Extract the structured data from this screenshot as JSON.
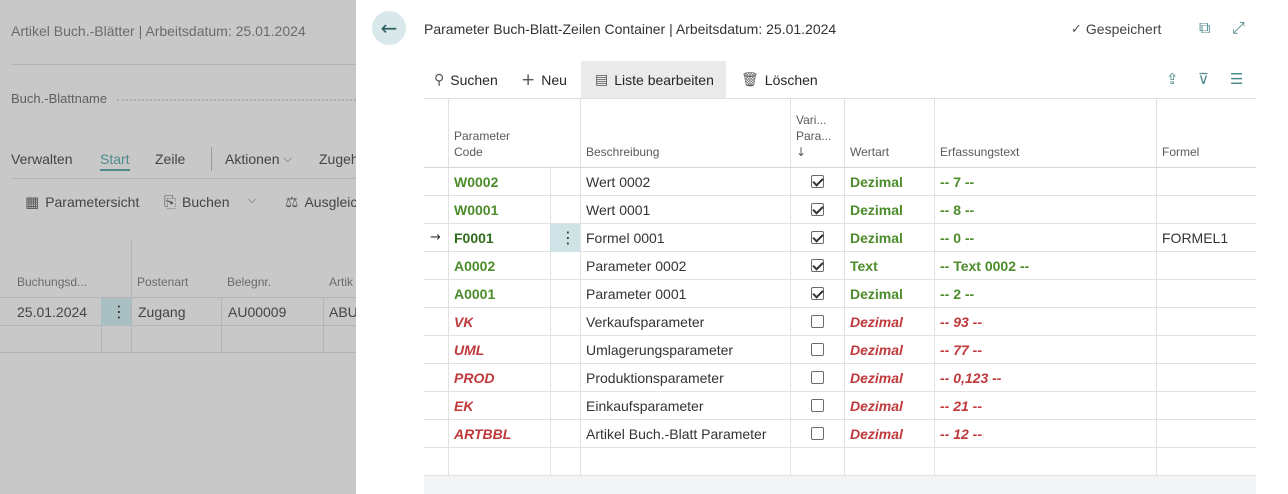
{
  "background": {
    "title": "Artikel Buch.-Blätter | Arbeitsdatum: 25.01.2024",
    "field_label": "Buch.-Blattname",
    "tabs": [
      "Verwalten",
      "Start",
      "Zeile",
      "Aktionen",
      "Zugeh"
    ],
    "active_tab": "Start",
    "actions": [
      "Parametersicht",
      "Buchen",
      "Ausgleic"
    ],
    "columns": [
      "Buchungsd...",
      "Postenart",
      "Belegnr.",
      "Artik"
    ],
    "row": [
      "25.01.2024",
      "Zugang",
      "AU00009",
      "ABU"
    ]
  },
  "panel": {
    "title": "Parameter Buch-Blatt-Zeilen Container | Arbeitsdatum: 25.01.2024",
    "saved_label": "Gespeichert",
    "actions": {
      "search": "Suchen",
      "new": "Neu",
      "edit_list": "Liste bearbeiten",
      "delete": "Löschen"
    },
    "columns": {
      "code_line1": "Parameter",
      "code_line2": "Code",
      "beschreibung": "Beschreibung",
      "var_line1": "Vari...",
      "var_line2": "Para...",
      "var_sort": "↓",
      "wertart": "Wertart",
      "erfassungstext": "Erfassungstext",
      "formel": "Formel"
    },
    "rows": [
      {
        "code": "W0002",
        "beschreibung": "Wert 0002",
        "checked": true,
        "wertart": "Dezimal",
        "erfassung": "-- 7 --",
        "formel": "",
        "style": "green"
      },
      {
        "code": "W0001",
        "beschreibung": "Wert 0001",
        "checked": true,
        "wertart": "Dezimal",
        "erfassung": "-- 8 --",
        "formel": "",
        "style": "green"
      },
      {
        "code": "F0001",
        "beschreibung": "Formel 0001",
        "checked": true,
        "wertart": "Dezimal",
        "erfassung": "-- 0 --",
        "formel": "FORMEL1",
        "style": "green-dark",
        "selected": true
      },
      {
        "code": "A0002",
        "beschreibung": "Parameter 0002",
        "checked": true,
        "wertart": "Text",
        "erfassung": "-- Text 0002 --",
        "formel": "",
        "style": "green"
      },
      {
        "code": "A0001",
        "beschreibung": "Parameter 0001",
        "checked": true,
        "wertart": "Dezimal",
        "erfassung": "-- 2 --",
        "formel": "",
        "style": "green"
      },
      {
        "code": "VK",
        "beschreibung": "Verkaufsparameter",
        "checked": false,
        "wertart": "Dezimal",
        "erfassung": "-- 93 --",
        "formel": "",
        "style": "red"
      },
      {
        "code": "UML",
        "beschreibung": "Umlagerungsparameter",
        "checked": false,
        "wertart": "Dezimal",
        "erfassung": "-- 77 --",
        "formel": "",
        "style": "red"
      },
      {
        "code": "PROD",
        "beschreibung": "Produktionsparameter",
        "checked": false,
        "wertart": "Dezimal",
        "erfassung": "-- 0,123 --",
        "formel": "",
        "style": "red"
      },
      {
        "code": "EK",
        "beschreibung": "Einkaufsparameter",
        "checked": false,
        "wertart": "Dezimal",
        "erfassung": "-- 21 --",
        "formel": "",
        "style": "red"
      },
      {
        "code": "ARTBBL",
        "beschreibung": "Artikel Buch.-Blatt Parameter",
        "checked": false,
        "wertart": "Dezimal",
        "erfassung": "-- 12 --",
        "formel": "",
        "style": "red"
      }
    ]
  },
  "colors": {
    "accent": "#4f8a8c",
    "green_text": "#4c8c2b",
    "red_text": "#c0393b"
  },
  "icons": [
    "back-arrow-icon",
    "checkmark-icon",
    "popout-icon",
    "expand-icon",
    "search-icon",
    "plus-icon",
    "edit-list-icon",
    "trash-icon",
    "share-icon",
    "filter-icon",
    "list-icon",
    "grid-icon",
    "post-icon",
    "chevron-down-icon",
    "kebab-icon",
    "row-arrow-icon"
  ]
}
